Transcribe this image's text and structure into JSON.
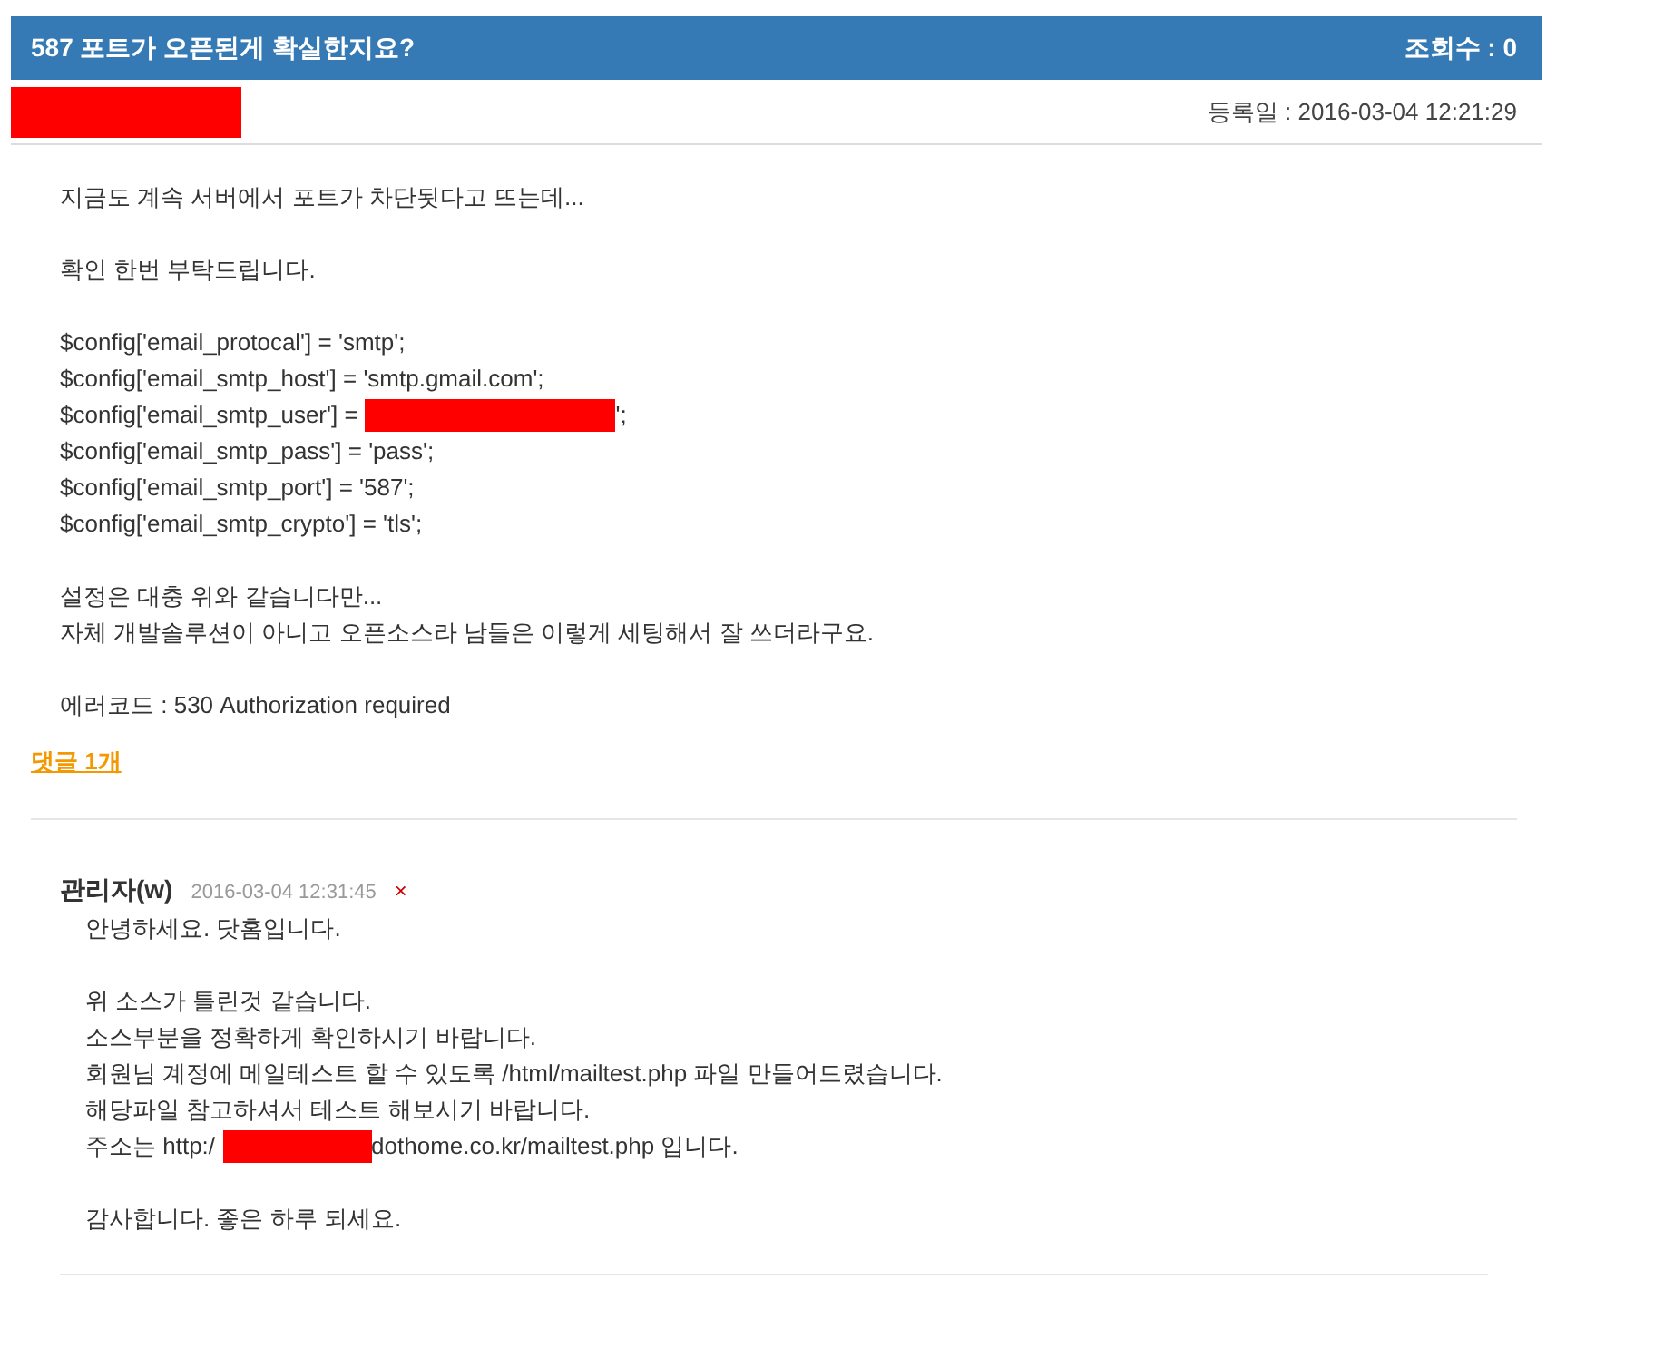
{
  "post": {
    "title": "587 포트가 오픈된게 확실한지요?",
    "views": "조회수 : 0",
    "date": "등록일 : 2016-03-04 12:21:29",
    "author_redacted": true,
    "body": [
      {
        "kind": "text",
        "text": "지금도 계속 서버에서 포트가 차단됫다고 뜨는데..."
      },
      {
        "kind": "blank"
      },
      {
        "kind": "text",
        "text": "확인 한번 부탁드립니다."
      },
      {
        "kind": "blank"
      },
      {
        "kind": "text",
        "text": "$config['email_protocal'] = 'smtp';"
      },
      {
        "kind": "text",
        "text": "$config['email_smtp_host'] = 'smtp.gmail.com';"
      },
      {
        "kind": "redacted",
        "before": "$config['email_smtp_user'] =",
        "after": "';"
      },
      {
        "kind": "text",
        "text": "$config['email_smtp_pass'] = 'pass';"
      },
      {
        "kind": "text",
        "text": "$config['email_smtp_port'] = '587';"
      },
      {
        "kind": "text",
        "text": "$config['email_smtp_crypto'] = 'tls';"
      },
      {
        "kind": "blank"
      },
      {
        "kind": "text",
        "text": "설정은 대충 위와 같습니다만..."
      },
      {
        "kind": "text",
        "text": "자체 개발솔루션이 아니고 오픈소스라 남들은 이렇게 세팅해서 잘 쓰더라구요."
      },
      {
        "kind": "blank"
      },
      {
        "kind": "text",
        "text": "에러코드 : 530 Authorization required"
      }
    ]
  },
  "comment_link": "댓글 1개",
  "comments": [
    {
      "author": "관리자(w)",
      "date": "2016-03-04 12:31:45",
      "delete": "×",
      "body": [
        {
          "kind": "text",
          "text": "안녕하세요. 닷홈입니다."
        },
        {
          "kind": "blank"
        },
        {
          "kind": "text",
          "text": "위 소스가 틀린것 같습니다."
        },
        {
          "kind": "text",
          "text": "소스부분을 정확하게 확인하시기 바랍니다."
        },
        {
          "kind": "text",
          "text": "회원님 계정에 메일테스트 할 수 있도록 /html/mailtest.php 파일 만들어드렸습니다."
        },
        {
          "kind": "text",
          "text": "해당파일 참고하셔서 테스트 해보시기 바랍니다."
        },
        {
          "kind": "redacted",
          "before": "주소는 http:/",
          "after": "dothome.co.kr/mailtest.php 입니다."
        },
        {
          "kind": "blank"
        },
        {
          "kind": "text",
          "text": "감사합니다. 좋은 하루 되세요."
        }
      ]
    }
  ]
}
